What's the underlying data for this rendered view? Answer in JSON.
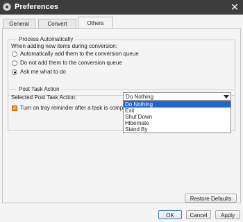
{
  "window": {
    "title": "Preferences"
  },
  "tabs": [
    {
      "label": "General"
    },
    {
      "label": "Convert"
    },
    {
      "label": "Others"
    }
  ],
  "process_group": {
    "title": "Process Automatically",
    "prompt": "When adding new items during conversion:",
    "options": [
      {
        "label": "Automatically add them to the conversion queue",
        "selected": false
      },
      {
        "label": "Do not add them to the conversion queue",
        "selected": false
      },
      {
        "label": "Ask me what to do",
        "selected": true
      }
    ]
  },
  "post_task_group": {
    "title": "Post Task Action",
    "select_label": "Selected Post Task Action:",
    "selected_value": "Do Nothing",
    "options": [
      "Do Nothing",
      "Exit",
      "Shut Down",
      "Hibernate",
      "Stand By"
    ],
    "tray_reminder_label": "Turn on tray reminder after a task is complete",
    "tray_reminder_checked": true
  },
  "buttons": {
    "restore_defaults": "Restore Defaults",
    "ok": "OK",
    "cancel": "Cancel",
    "apply": "Apply"
  },
  "colors": {
    "titlebar": "#3d3d3d",
    "checkbox_accent": "#f08a24",
    "selection": "#1e64d2"
  }
}
